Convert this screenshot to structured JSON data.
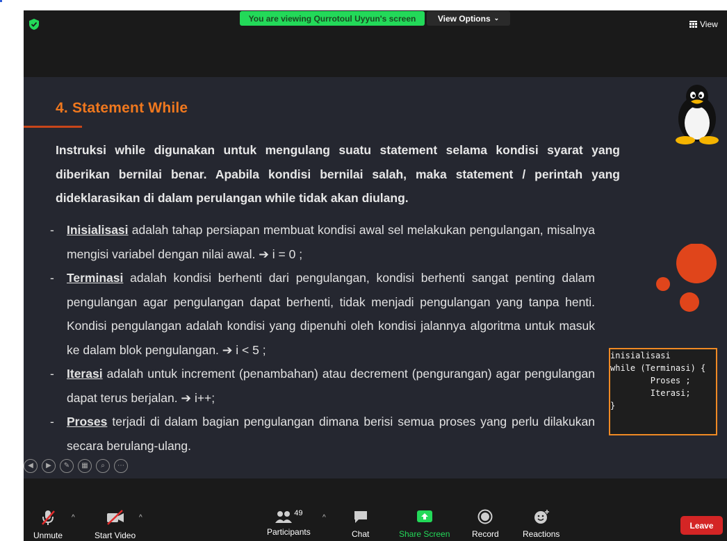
{
  "window": {
    "banner_text": "You are viewing Qurrotoul Uyyun's screen",
    "view_options_label": "View Options",
    "view_label": "View"
  },
  "slide": {
    "title": "4. Statement While",
    "intro": "Instruksi while digunakan untuk mengulang suatu statement selama kondisi syarat yang diberikan bernilai benar. Apabila kondisi bernilai salah, maka statement / perintah yang dideklarasikan di dalam perulangan while tidak akan diulang.",
    "bullets": [
      {
        "term": "Inisialisasi",
        "text": " adalah tahap persiapan membuat kondisi awal sel melakukan pengulangan, misalnya mengisi variabel dengan nilai awal. ➔  i = 0 ;"
      },
      {
        "term": "Terminasi",
        "text": " adalah kondisi berhenti dari pengulangan, kondisi berhenti sangat penting dalam pengulangan agar pengulangan dapat berhenti, tidak menjadi pengulangan yang tanpa henti. Kondisi pengulangan adalah kondisi yang dipenuhi oleh kondisi jalannya algoritma untuk masuk ke dalam blok pengulangan. ➔ i <  5  ;"
      },
      {
        "term": "Iterasi",
        "text": " adalah untuk increment (penambahan) atau decrement (pengurangan) agar pengulangan dapat terus berjalan.  ➔ i++;"
      },
      {
        "term": "Proses",
        "text": " terjadi di dalam bagian pengulangan dimana berisi semua proses yang perlu dilakukan secara berulang-ulang."
      }
    ],
    "code_lines": [
      "inisialisasi",
      "",
      "while (Terminasi) {",
      "        Proses ;",
      "        Iterasi;",
      "}"
    ]
  },
  "toolbar": {
    "unmute": "Unmute",
    "start_video": "Start Video",
    "participants": "Participants",
    "participant_count": "49",
    "chat": "Chat",
    "share_screen": "Share Screen",
    "record": "Record",
    "reactions": "Reactions",
    "leave": "Leave"
  },
  "colors": {
    "banner_green": "#23d959",
    "title_orange": "#f0781e",
    "leave_red": "#d42525",
    "slide_bg": "#252730"
  }
}
